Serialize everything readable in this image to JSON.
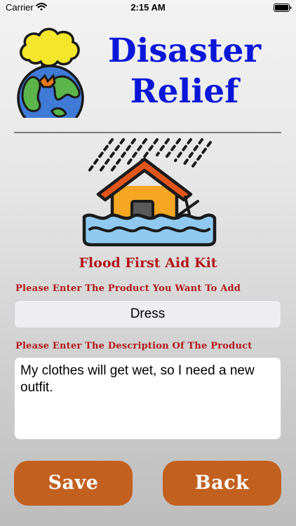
{
  "status_bar": {
    "carrier": "Carrier",
    "time": "2:15 AM"
  },
  "header": {
    "title_line1": "Disaster",
    "title_line2": "Relief",
    "title_color": "#0a17d8"
  },
  "kit": {
    "title": "Flood First Aid Kit"
  },
  "form": {
    "product_label": "Please Enter The Product You Want To Add",
    "product_value": "Dress",
    "description_label": "Please Enter The Description Of The Product",
    "description_value": "My clothes will get wet, so I need a new outfit.",
    "label_color": "#b1171b"
  },
  "buttons": {
    "save_label": "Save",
    "back_label": "Back",
    "button_color": "#c2601f"
  },
  "icons": {
    "logo": "earth-explosion-icon",
    "kit": "flooded-house-icon"
  }
}
